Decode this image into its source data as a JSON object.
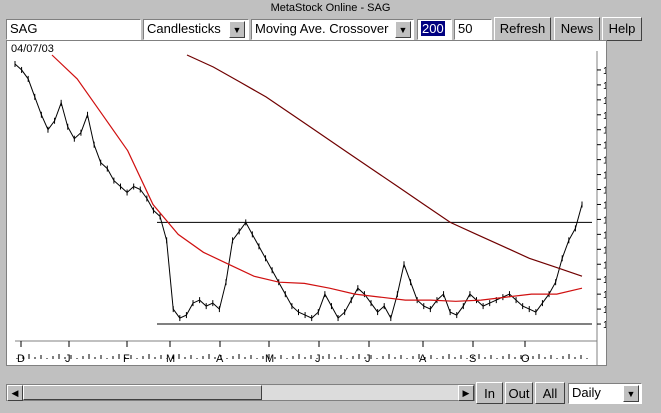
{
  "window": {
    "title": "MetaStock Online - SAG"
  },
  "toolbar": {
    "symbol": "SAG",
    "chart_style": "Candlesticks",
    "indicator": "Moving Ave. Crossover",
    "period1": "200",
    "period2": "50",
    "refresh_label": "Refresh",
    "news_label": "News",
    "help_label": "Help"
  },
  "chart": {
    "date_label": "04/07/03",
    "price_ticks": [
      "1.5750",
      "1.5500",
      "1.5250",
      "1.5000",
      "1.4750",
      "1.4500",
      "1.4250",
      "1.4000",
      "1.3750",
      "1.3500",
      "1.3250",
      "1.3000",
      "1.2750",
      "1.2500",
      "1.2250",
      "1.2000",
      "1.1750",
      "1.1500"
    ],
    "month_labels": [
      "D",
      "J",
      "F",
      "M",
      "A",
      "M",
      "J",
      "J",
      "A",
      "S",
      "O"
    ],
    "colors": {
      "price": "#000000",
      "ma50": "#d01010",
      "ma200": "#700000",
      "line": "#000000"
    }
  },
  "chart_data": {
    "type": "line",
    "series": [
      {
        "values": [
          1.585,
          1.575,
          1.56,
          1.53,
          1.5,
          1.475,
          1.49,
          1.52,
          1.48,
          1.46,
          1.47,
          1.5,
          1.45,
          1.42,
          1.41,
          1.39,
          1.38,
          1.37,
          1.38,
          1.375,
          1.36,
          1.34,
          1.33,
          1.29,
          1.175,
          1.16,
          1.165,
          1.185,
          1.19,
          1.18,
          1.185,
          1.175,
          1.22,
          1.29,
          1.305,
          1.32,
          1.3,
          1.28,
          1.26,
          1.24,
          1.22,
          1.2,
          1.18,
          1.17,
          1.165,
          1.16,
          1.17,
          1.2,
          1.18,
          1.16,
          1.17,
          1.19,
          1.21,
          1.2,
          1.185,
          1.17,
          1.18,
          1.16,
          1.2,
          1.25,
          1.22,
          1.19,
          1.18,
          1.175,
          1.19,
          1.2,
          1.17,
          1.165,
          1.18,
          1.2,
          1.19,
          1.18,
          1.185,
          1.19,
          1.195,
          1.2,
          1.19,
          1.18,
          1.175,
          1.17,
          1.185,
          1.2,
          1.22,
          1.26,
          1.29,
          1.31,
          1.35
        ]
      },
      {
        "values": [
          1.6,
          1.56,
          1.5,
          1.44,
          1.35,
          1.3,
          1.27,
          1.25,
          1.23,
          1.22,
          1.218,
          1.21,
          1.2,
          1.195,
          1.19,
          1.19,
          1.188,
          1.19,
          1.195,
          1.2,
          1.2,
          1.21
        ]
      },
      {
        "values": [
          1.6,
          1.58,
          1.555,
          1.53,
          1.5,
          1.47,
          1.44,
          1.41,
          1.38,
          1.35,
          1.32,
          1.3,
          1.28,
          1.26,
          1.245,
          1.23
        ]
      }
    ],
    "hlines": [
      1.32,
      1.15
    ],
    "ylim": [
      1.13,
      1.6
    ]
  },
  "navigation": {
    "zoom_in_label": "In",
    "zoom_out_label": "Out",
    "all_label": "All",
    "periodicity": "Daily"
  }
}
